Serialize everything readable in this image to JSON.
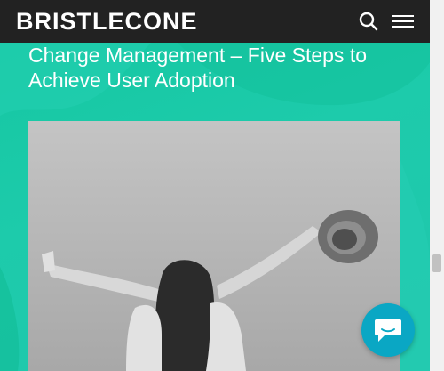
{
  "header": {
    "logo_text": "BRISTLECONE",
    "search_icon": "search-icon",
    "menu_icon": "hamburger-menu-icon"
  },
  "article": {
    "title": "Change Management – Five Steps to Achieve User Adoption"
  },
  "chat": {
    "icon": "chat-bubble-icon"
  },
  "colors": {
    "header_bg": "#222222",
    "page_bg": "#1dcbab",
    "chat_button": "#0aa7c4",
    "text": "#ffffff"
  }
}
